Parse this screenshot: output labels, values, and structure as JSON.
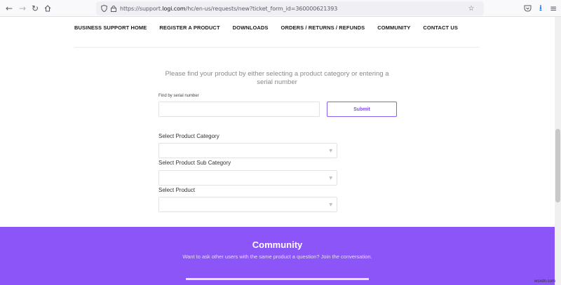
{
  "browser": {
    "url_prefix": "https://support.",
    "url_domain": "logi.com",
    "url_rest": "/hc/en-us/requests/new?ticket_form_id=360000621393",
    "icons": [
      "back-icon",
      "forward-icon",
      "reload-icon",
      "home-icon",
      "shield-icon",
      "lock-icon",
      "star-icon",
      "pocket-icon",
      "download-icon",
      "menu-icon"
    ]
  },
  "nav": {
    "items": [
      "BUSINESS SUPPORT HOME",
      "REGISTER A PRODUCT",
      "DOWNLOADS",
      "ORDERS / RETURNS / REFUNDS",
      "COMMUNITY",
      "CONTACT US"
    ]
  },
  "form": {
    "intro": "Please find your product by either selecting a product category or entering a serial number",
    "serial_label": "Find by serial number",
    "serial_value": "",
    "submit_label": "Submit",
    "category_label": "Select Product Category",
    "subcategory_label": "Select Product Sub Category",
    "product_label": "Select Product",
    "category_value": "",
    "subcategory_value": "",
    "product_value": ""
  },
  "community": {
    "title": "Community",
    "subtitle": "Want to ask other users with the same product a question? Join the conversation."
  },
  "watermark": "wsxdn.com",
  "colors": {
    "accent": "#8b55f7",
    "submit_text": "#7d4ff0"
  }
}
